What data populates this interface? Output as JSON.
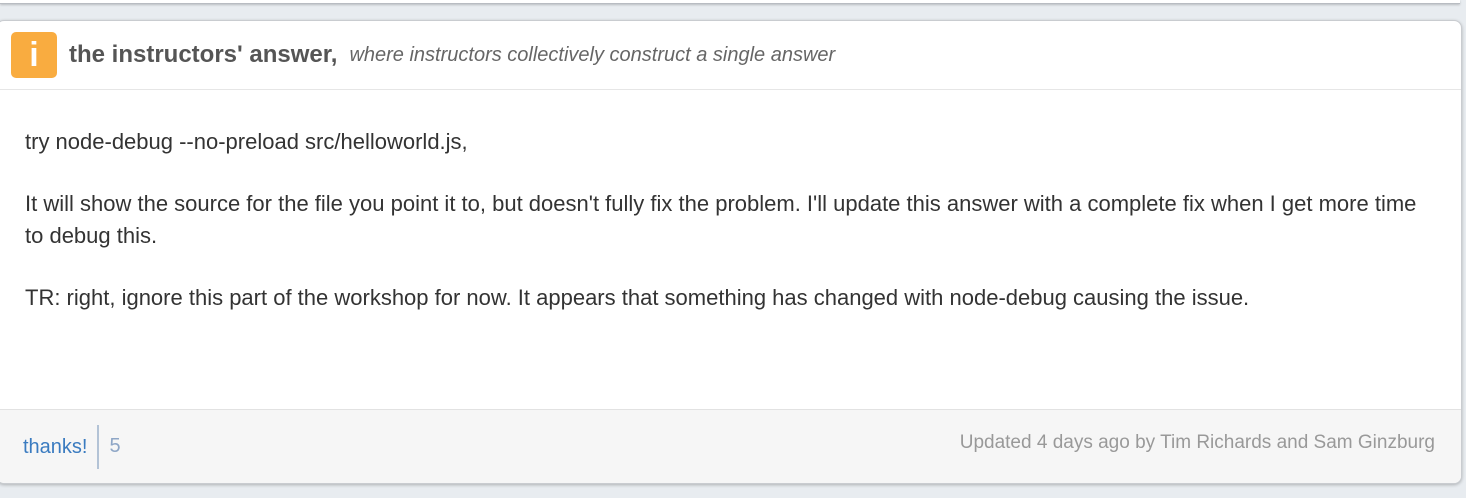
{
  "header": {
    "badge": "i",
    "title": "the instructors' answer,",
    "subtitle": "where instructors collectively construct a single answer"
  },
  "body": {
    "paragraphs": [
      "try node-debug --no-preload src/helloworld.js,",
      "It will show the source for the file you point it to, but doesn't fully fix the problem. I'll update this answer with a complete fix when I get more time to debug this.",
      "TR: right, ignore this part of the workshop for now. It appears that something has changed with node-debug causing the issue."
    ]
  },
  "footer": {
    "thanks_label": "thanks!",
    "thanks_count": "5",
    "updated": "Updated 4 days ago by Tim Richards and Sam Ginzburg"
  },
  "colors": {
    "badge": "#f9ac40",
    "link": "#3a7bc0"
  }
}
